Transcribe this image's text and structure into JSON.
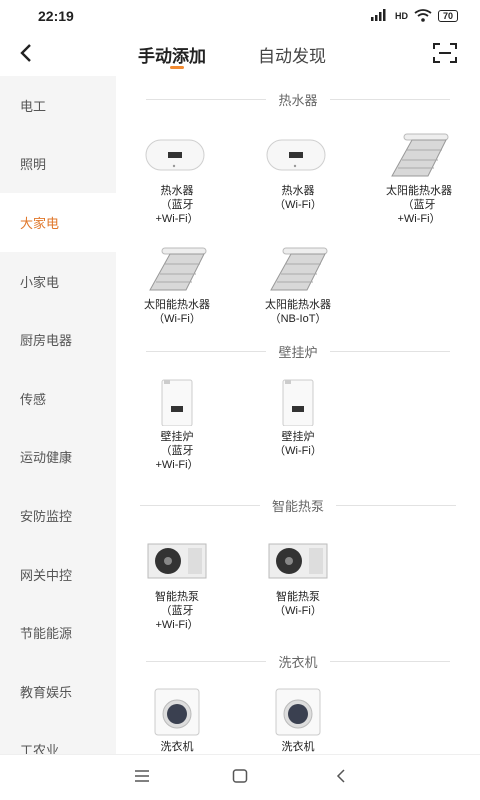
{
  "status": {
    "time": "22:19",
    "network": "HD",
    "battery": "70"
  },
  "header": {
    "tabs": [
      {
        "label": "手动添加"
      },
      {
        "label": "自动发现"
      }
    ]
  },
  "sidebar": {
    "items": [
      {
        "label": "电工"
      },
      {
        "label": "照明"
      },
      {
        "label": "大家电"
      },
      {
        "label": "小家电"
      },
      {
        "label": "厨房电器"
      },
      {
        "label": "传感"
      },
      {
        "label": "运动健康"
      },
      {
        "label": "安防监控"
      },
      {
        "label": "网关中控"
      },
      {
        "label": "节能能源"
      },
      {
        "label": "教育娱乐"
      },
      {
        "label": "工农业"
      }
    ],
    "active_index": 2
  },
  "sections": [
    {
      "title": "热水器",
      "devices": [
        {
          "name1": "热水器",
          "name2": "（蓝牙",
          "name3": "+Wi-Fi）",
          "icon": "water-heater"
        },
        {
          "name1": "热水器",
          "name2": "（Wi-Fi）",
          "name3": "",
          "icon": "water-heater"
        },
        {
          "name1": "太阳能热水器",
          "name2": "（蓝牙",
          "name3": "+Wi-Fi）",
          "icon": "solar-heater"
        },
        {
          "name1": "太阳能热水器",
          "name2": "（Wi-Fi）",
          "name3": "",
          "icon": "solar-heater"
        },
        {
          "name1": "太阳能热水器",
          "name2": "（NB-IoT）",
          "name3": "",
          "icon": "solar-heater"
        }
      ]
    },
    {
      "title": "壁挂炉",
      "devices": [
        {
          "name1": "壁挂炉",
          "name2": "（蓝牙",
          "name3": "+Wi-Fi）",
          "icon": "wall-boiler"
        },
        {
          "name1": "壁挂炉",
          "name2": "（Wi-Fi）",
          "name3": "",
          "icon": "wall-boiler"
        }
      ]
    },
    {
      "title": "智能热泵",
      "devices": [
        {
          "name1": "智能热泵",
          "name2": "（蓝牙",
          "name3": "+Wi-Fi）",
          "icon": "heat-pump"
        },
        {
          "name1": "智能热泵",
          "name2": "（Wi-Fi）",
          "name3": "",
          "icon": "heat-pump"
        }
      ]
    },
    {
      "title": "洗衣机",
      "devices": [
        {
          "name1": "洗衣机",
          "name2": "",
          "name3": "",
          "icon": "washing-machine"
        },
        {
          "name1": "洗衣机",
          "name2": "",
          "name3": "",
          "icon": "washing-machine"
        }
      ]
    }
  ],
  "colors": {
    "accent": "#e0772a",
    "sidebar_bg": "#f5f5f5"
  },
  "icons": {
    "back": "back-arrow-icon",
    "scan": "scan-icon",
    "nav": [
      "menu-icon",
      "home-icon",
      "back-icon"
    ]
  }
}
